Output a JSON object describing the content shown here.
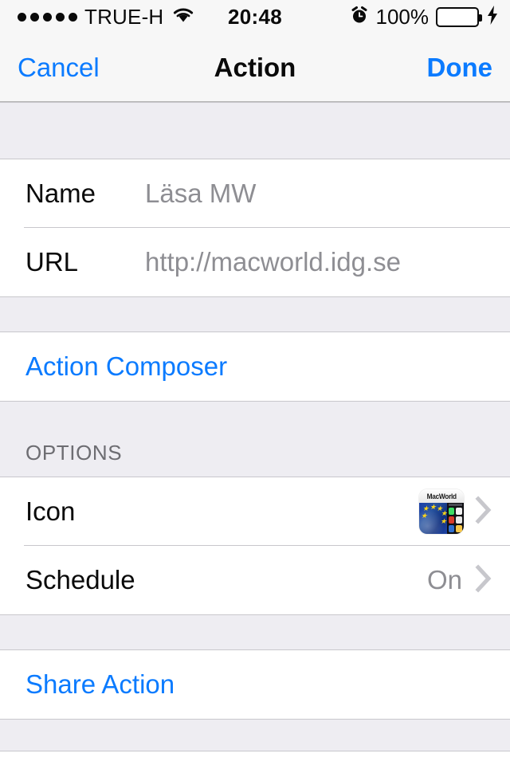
{
  "status_bar": {
    "signal_dots": 5,
    "carrier": "TRUE-H",
    "wifi_icon": "wifi-icon",
    "time": "20:48",
    "alarm_icon": "alarm-clock-icon",
    "battery_percent": "100%",
    "battery_fill_color": "#4cd964",
    "charging_icon": "lightning-bolt-icon"
  },
  "nav_bar": {
    "cancel_label": "Cancel",
    "title": "Action",
    "done_label": "Done",
    "tint_color": "#0b7bff"
  },
  "form": {
    "fields": [
      {
        "label": "Name",
        "value": "Läsa MW"
      },
      {
        "label": "URL",
        "value": "http://macworld.idg.se"
      }
    ],
    "composer_label": "Action Composer"
  },
  "options": {
    "header": "OPTIONS",
    "rows": [
      {
        "label": "Icon",
        "icon_name": "macworld-app-icon",
        "icon_caption": "MacWorld",
        "accessory": "chevron-right-icon"
      },
      {
        "label": "Schedule",
        "value": "On",
        "accessory": "chevron-right-icon"
      }
    ]
  },
  "share": {
    "label": "Share Action"
  },
  "colors": {
    "accent_blue": "#0b7bff",
    "group_background": "#eeedf2",
    "separator": "#c8c7cc",
    "secondary_text": "#8e8e93",
    "header_text": "#6d6d72"
  }
}
